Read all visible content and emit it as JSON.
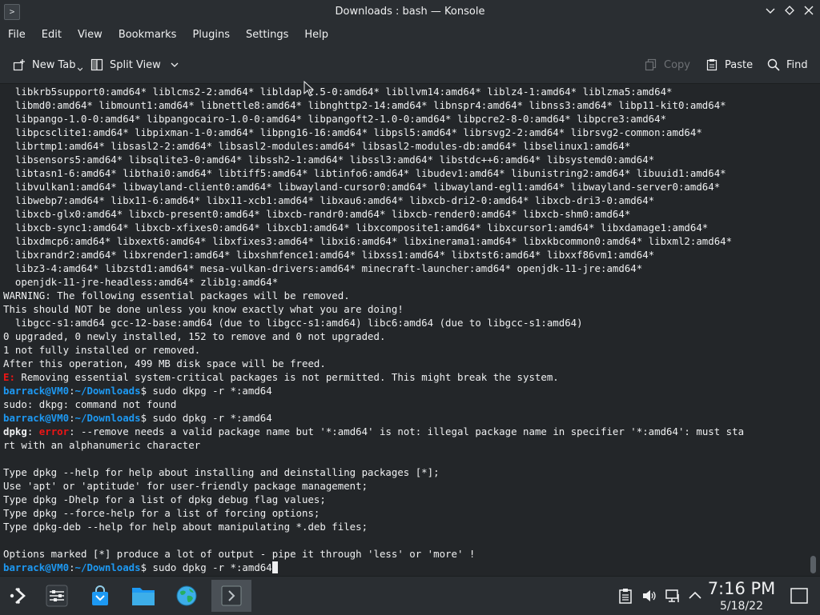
{
  "window": {
    "title": "Downloads : bash — Konsole"
  },
  "menu": [
    "File",
    "Edit",
    "View",
    "Bookmarks",
    "Plugins",
    "Settings",
    "Help"
  ],
  "toolbar": {
    "new_tab": "New Tab",
    "split_view": "Split View",
    "copy": "Copy",
    "paste": "Paste",
    "find": "Find"
  },
  "terminal": {
    "lines": [
      "  libkrb5support0:amd64* liblcms2-2:amd64* libldap-2.5-0:amd64* libllvm14:amd64* liblz4-1:amd64* liblzma5:amd64*",
      "  libmd0:amd64* libmount1:amd64* libnettle8:amd64* libnghttp2-14:amd64* libnspr4:amd64* libnss3:amd64* libp11-kit0:amd64*",
      "  libpango-1.0-0:amd64* libpangocairo-1.0-0:amd64* libpangoft2-1.0-0:amd64* libpcre2-8-0:amd64* libpcre3:amd64*",
      "  libpcsclite1:amd64* libpixman-1-0:amd64* libpng16-16:amd64* libpsl5:amd64* librsvg2-2:amd64* librsvg2-common:amd64*",
      "  librtmp1:amd64* libsasl2-2:amd64* libsasl2-modules:amd64* libsasl2-modules-db:amd64* libselinux1:amd64*",
      "  libsensors5:amd64* libsqlite3-0:amd64* libssh2-1:amd64* libssl3:amd64* libstdc++6:amd64* libsystemd0:amd64*",
      "  libtasn1-6:amd64* libthai0:amd64* libtiff5:amd64* libtinfo6:amd64* libudev1:amd64* libunistring2:amd64* libuuid1:amd64*",
      "  libvulkan1:amd64* libwayland-client0:amd64* libwayland-cursor0:amd64* libwayland-egl1:amd64* libwayland-server0:amd64*",
      "  libwebp7:amd64* libx11-6:amd64* libx11-xcb1:amd64* libxau6:amd64* libxcb-dri2-0:amd64* libxcb-dri3-0:amd64*",
      "  libxcb-glx0:amd64* libxcb-present0:amd64* libxcb-randr0:amd64* libxcb-render0:amd64* libxcb-shm0:amd64*",
      "  libxcb-sync1:amd64* libxcb-xfixes0:amd64* libxcb1:amd64* libxcomposite1:amd64* libxcursor1:amd64* libxdamage1:amd64*",
      "  libxdmcp6:amd64* libxext6:amd64* libxfixes3:amd64* libxi6:amd64* libxinerama1:amd64* libxkbcommon0:amd64* libxml2:amd64*",
      "  libxrandr2:amd64* libxrender1:amd64* libxshmfence1:amd64* libxss1:amd64* libxtst6:amd64* libxxf86vm1:amd64*",
      "  libz3-4:amd64* libzstd1:amd64* mesa-vulkan-drivers:amd64* minecraft-launcher:amd64* openjdk-11-jre:amd64*",
      "  openjdk-11-jre-headless:amd64* zlib1g:amd64*",
      "WARNING: The following essential packages will be removed.",
      "This should NOT be done unless you know exactly what you are doing!",
      "  libgcc-s1:amd64 gcc-12-base:amd64 (due to libgcc-s1:amd64) libc6:amd64 (due to libgcc-s1:amd64)",
      "0 upgraded, 0 newly installed, 152 to remove and 0 not upgraded.",
      "1 not fully installed or removed.",
      "After this operation, 499 MB disk space will be freed."
    ],
    "e_prefix": "E:",
    "e_text": " Removing essential system-critical packages is not permitted. This might break the system.",
    "prompt_user": "barrack@VM0",
    "prompt_sep": ":",
    "prompt_path": "~/Downloads",
    "prompt_sign": "$",
    "cmd1": " sudo dkpg -r *:amd64",
    "out1": "sudo: dkpg: command not found",
    "cmd2": " sudo dpkg -r *:amd64",
    "dpkg_label": "dpkg",
    "colon": ":",
    "error_label": " error",
    "dpkg_msg": ": --remove needs a valid package name but '*:amd64' is not: illegal package name in specifier '*:amd64': must sta",
    "dpkg_msg2": "rt with an alphanumeric character",
    "help_lines": [
      "Type dpkg --help for help about installing and deinstalling packages [*];",
      "Use 'apt' or 'aptitude' for user-friendly package management;",
      "Type dpkg -Dhelp for a list of dpkg debug flag values;",
      "Type dpkg --force-help for a list of forcing options;",
      "Type dpkg-deb --help for help about manipulating *.deb files;"
    ],
    "options_line": "Options marked [*] produce a lot of output - pipe it through 'less' or 'more' !",
    "cmd3": " sudo dpkg -r *:amd64"
  },
  "clock": {
    "time": "7:16 PM",
    "date": "5/18/22"
  },
  "colors": {
    "prompt": "#1d99f3",
    "error": "#ed1515",
    "background": "#232629"
  }
}
